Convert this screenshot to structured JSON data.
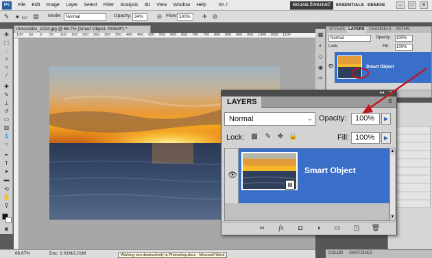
{
  "menubar": {
    "logo": "Ps",
    "items": [
      "File",
      "Edit",
      "Image",
      "Layer",
      "Select",
      "Filter",
      "Analysis",
      "3D",
      "View",
      "Window",
      "Help"
    ],
    "zoom": "66.7",
    "user": "BOJAN ŽIVKOVIĆ",
    "workspaces": [
      "ESSENTIALS",
      "DESIGN"
    ],
    "window_buttons": [
      "–",
      "□",
      "✕"
    ]
  },
  "options_bar": {
    "brush_size": "547",
    "mode_label": "Mode:",
    "mode_value": "Normal",
    "opacity_label": "Opacity:",
    "opacity_value": "34%",
    "flow_label": "Flow:",
    "flow_value": "100%"
  },
  "document": {
    "tab_title": "mmzoNDc_1024.jpg @ 66.7% (Smart Object, RGB/8*) *",
    "ruler_ticks": [
      "100",
      "50",
      "0",
      "50",
      "100",
      "150",
      "200",
      "250",
      "300",
      "350",
      "400",
      "450",
      "500",
      "550",
      "600",
      "650",
      "700",
      "750",
      "800",
      "850",
      "900",
      "950",
      "1000",
      "1050",
      "1100"
    ],
    "status_zoom": "66.67%",
    "status_doc": "Doc: 2.01M/2.01M",
    "taskbar_tip": "Working non destructively in Photoshop.docx - Microsoft Word"
  },
  "small_layers_panel": {
    "tabs": [
      "STYLES",
      "LAYERS",
      "CHANNELS",
      "PATHS"
    ],
    "active_tab": "LAYERS",
    "blend": "Normal",
    "opacity_label": "Opacity:",
    "opacity_value": "100%",
    "lock_label": "Lock:",
    "fill_label": "Fill:",
    "fill_value": "100%",
    "layer_name": "Smart Object"
  },
  "color_tabs": [
    "COLOR",
    "SWATCHES"
  ],
  "layers_panel": {
    "title": "LAYERS",
    "blend_mode": "Normal",
    "opacity_label": "Opacity:",
    "opacity_value": "100%",
    "lock_label": "Lock:",
    "fill_label": "Fill:",
    "fill_value": "100%",
    "layer_name": "Smart Object",
    "menu_icon": "≡"
  },
  "colors": {
    "selection_blue": "#3a6fc9",
    "annotation_red": "#c0161d"
  }
}
